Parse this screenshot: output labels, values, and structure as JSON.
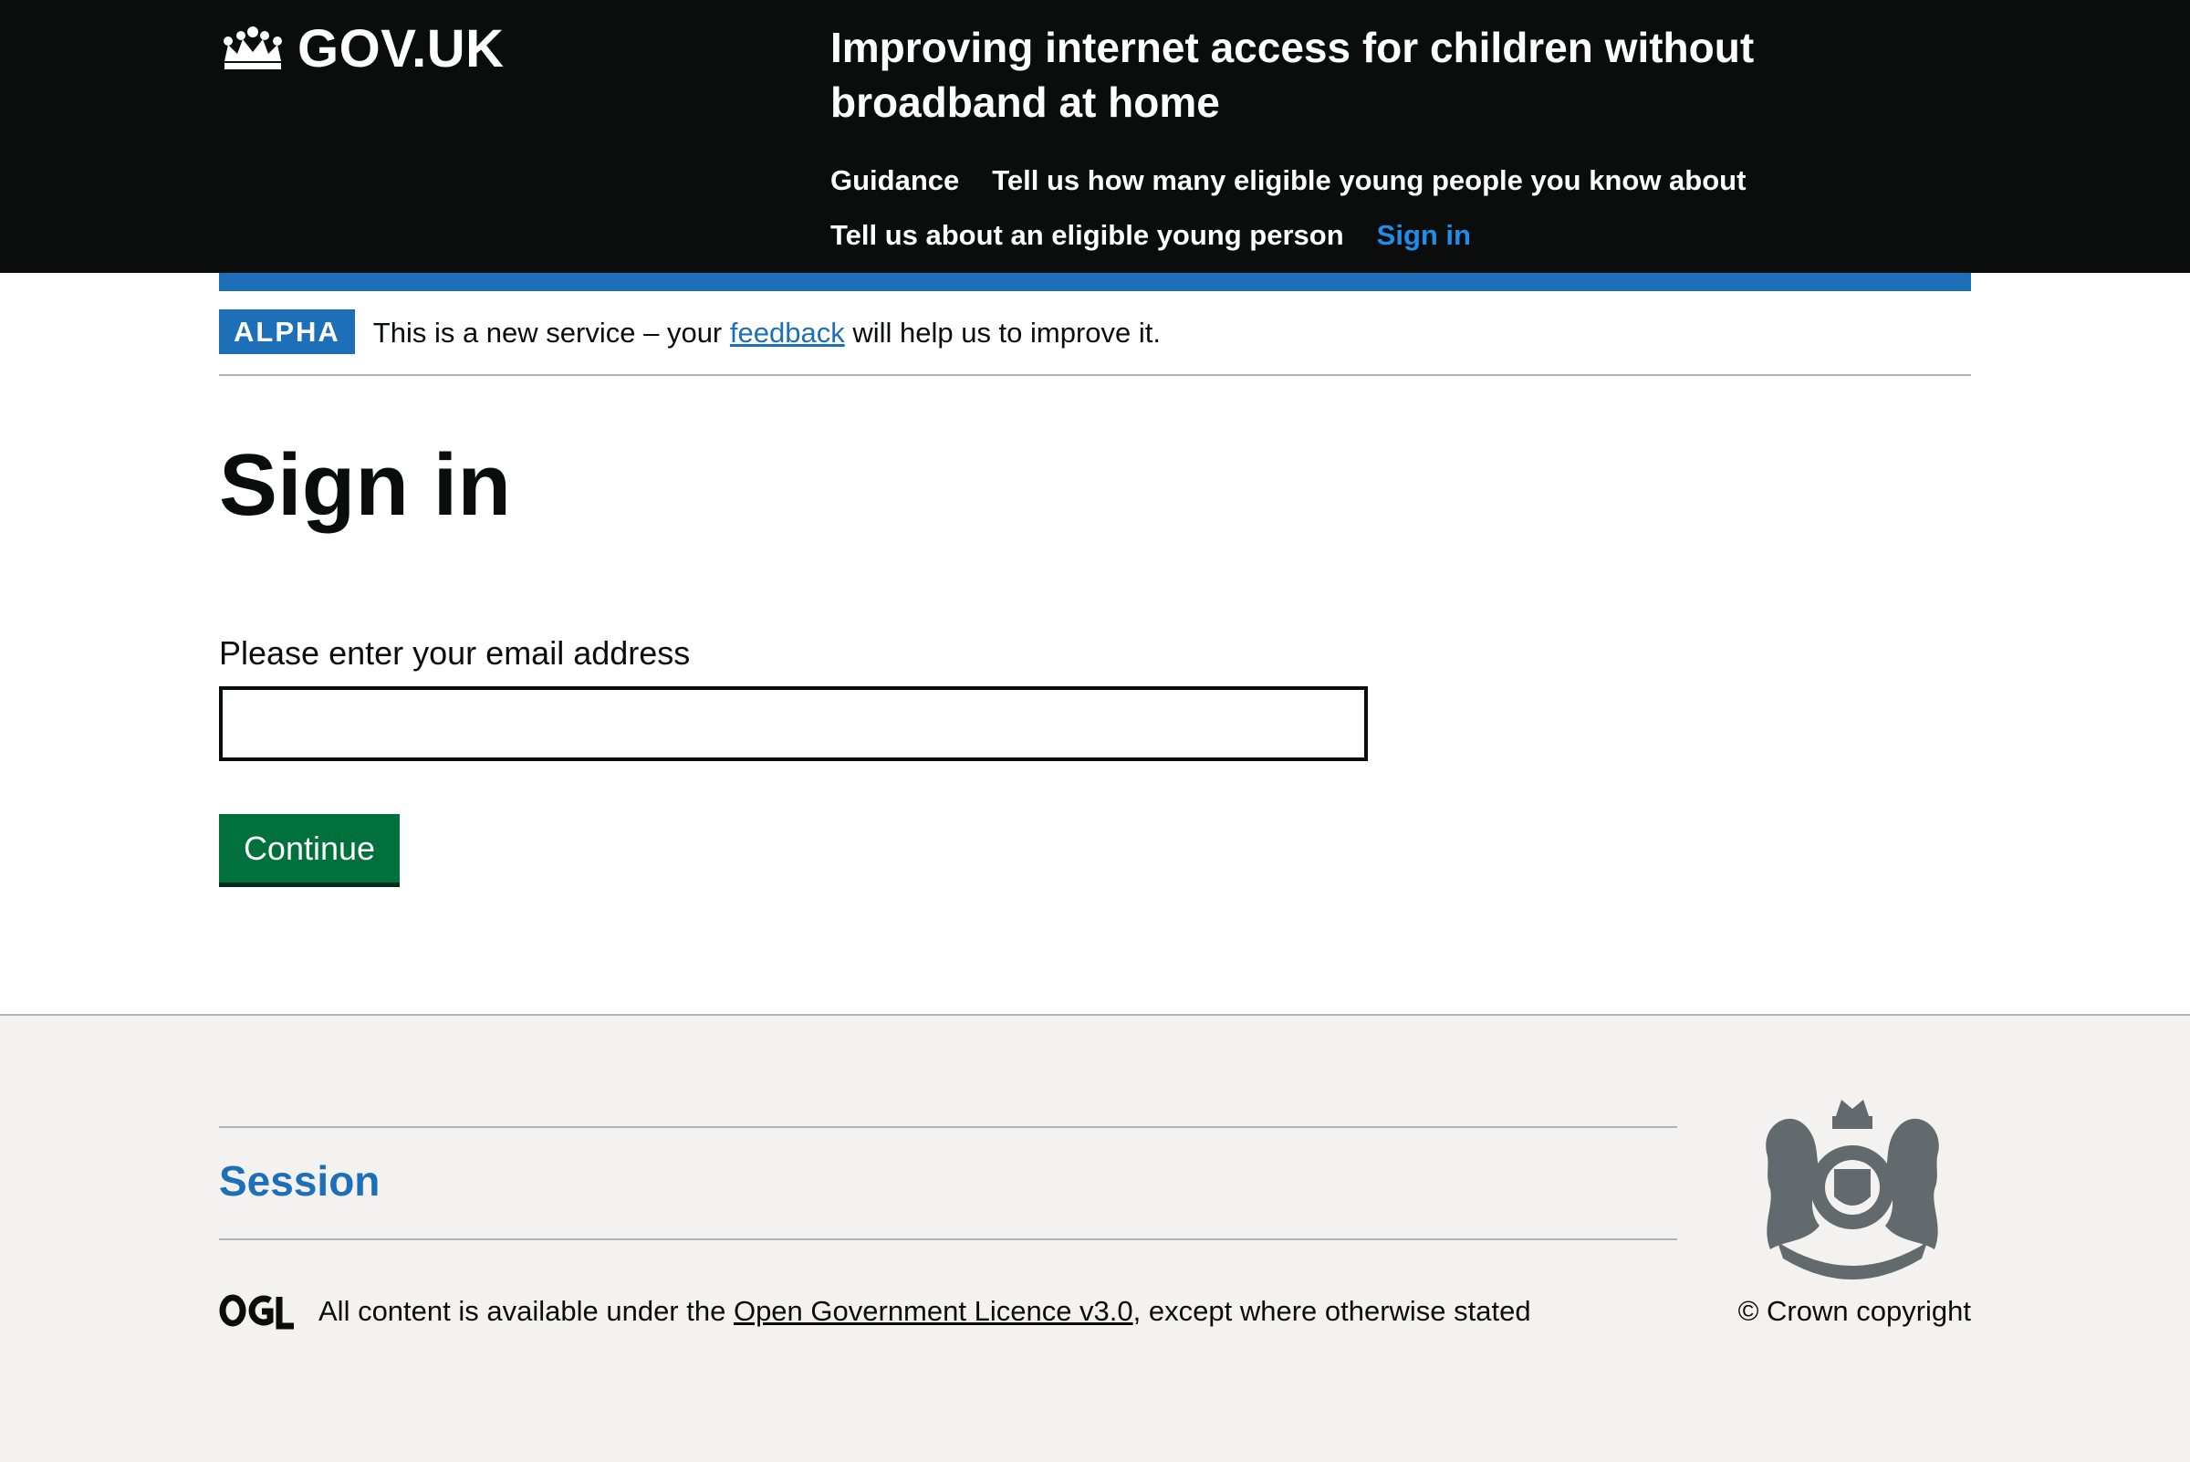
{
  "header": {
    "logo_text": "GOV.UK",
    "service_name": "Improving internet access for children without broadband at home",
    "nav": [
      {
        "label": "Guidance"
      },
      {
        "label": "Tell us how many eligible young people you know about"
      },
      {
        "label": "Tell us about an eligible young person"
      },
      {
        "label": "Sign in"
      }
    ]
  },
  "phase_banner": {
    "tag": "ALPHA",
    "text_before": "This is a new service – your ",
    "link": "feedback",
    "text_after": " will help us to improve it."
  },
  "main": {
    "title": "Sign in",
    "email_label": "Please enter your email address",
    "email_value": "",
    "continue_label": "Continue"
  },
  "footer": {
    "section_link": "Session",
    "licence_before": "All content is available under the ",
    "licence_link": "Open Government Licence v3.0",
    "licence_after": ", except where otherwise stated",
    "copyright": "© Crown copyright"
  },
  "colors": {
    "header_bg": "#0b0c0c",
    "brand_blue": "#1d70b8",
    "active_nav": "#1d8feb",
    "button_green": "#00703c",
    "footer_bg": "#f3f2f1"
  }
}
